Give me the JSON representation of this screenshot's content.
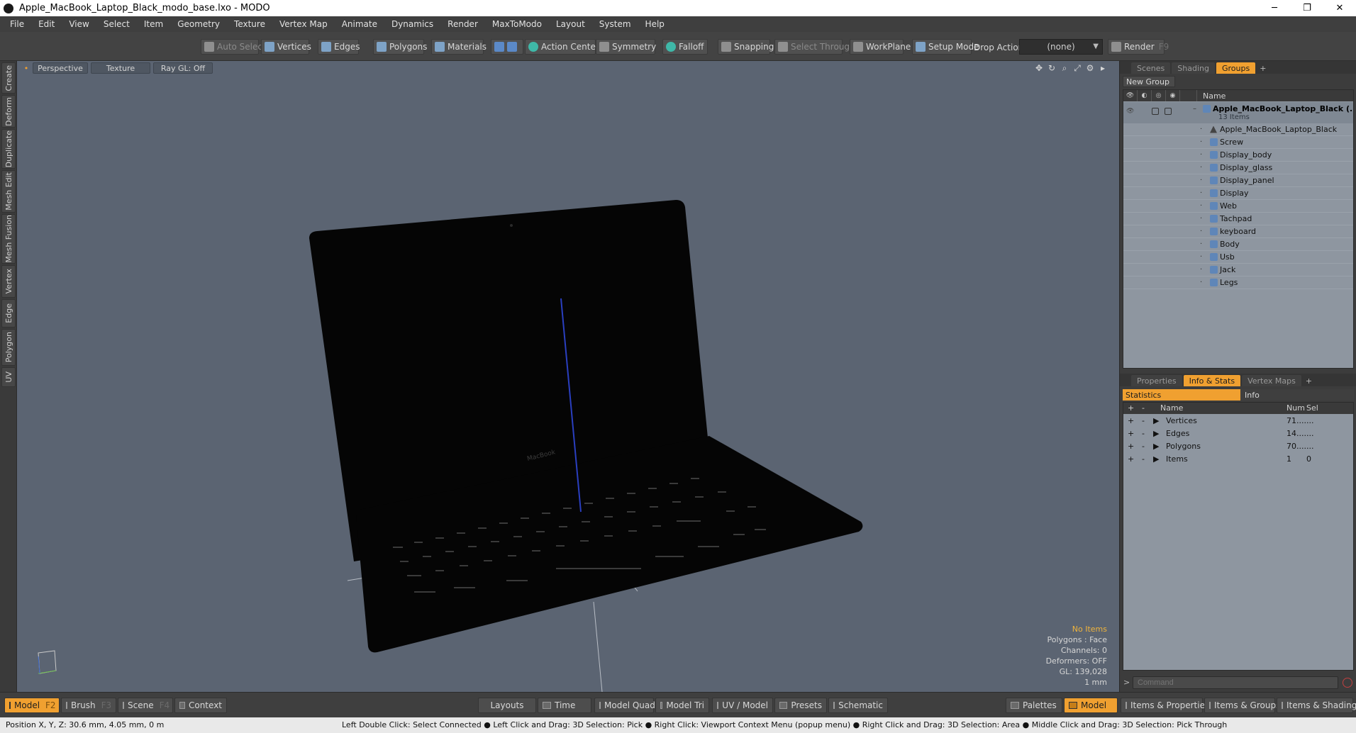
{
  "window": {
    "title": "Apple_MacBook_Laptop_Black_modo_base.lxo - MODO",
    "controls": {
      "minimize": "─",
      "maximize": "❐",
      "close": "✕"
    }
  },
  "menu": [
    "File",
    "Edit",
    "View",
    "Select",
    "Item",
    "Geometry",
    "Texture",
    "Vertex Map",
    "Animate",
    "Dynamics",
    "Render",
    "MaxToModo",
    "Layout",
    "System",
    "Help"
  ],
  "toolbar": {
    "auto_select": "Auto Select",
    "vertices": "Vertices",
    "edges": "Edges",
    "polygons": "Polygons",
    "materials": "Materials",
    "action_center": "Action Center",
    "symmetry": "Symmetry",
    "falloff": "Falloff",
    "snapping": "Snapping",
    "select_through": "Select Through",
    "workplane": "WorkPlane",
    "setup_mode": "Setup Mode",
    "drop_action": "Drop Action",
    "drop_value": "(none)",
    "render": "Render",
    "render_key": "F9"
  },
  "left_tabs": [
    "Create",
    "Deform",
    "Duplicate",
    "Mesh Edit",
    "Mesh Fusion",
    "Vertex",
    "Edge",
    "Polygon",
    "UV"
  ],
  "viewport": {
    "view": "Perspective",
    "shading": "Texture",
    "raygl": "Ray GL: Off",
    "laptop_logo": "MacBook",
    "info": {
      "selection": "No Items",
      "polygons": "Polygons : Face",
      "channels": "Channels: 0",
      "deformers": "Deformers: OFF",
      "gl": "GL: 139,028",
      "unit": "1 mm"
    },
    "colors": {
      "background": "#5b6472",
      "axis": "#2a3fc0"
    }
  },
  "items_panel": {
    "tabs": [
      "Scenes",
      "Shading",
      "Groups"
    ],
    "active_tab": "Groups",
    "new_group": "New Group",
    "name_header": "Name",
    "root": {
      "name": "Apple_MacBook_Laptop_Black",
      "suffix": "(...",
      "count": "13 Items"
    },
    "items": [
      "Apple_MacBook_Laptop_Black",
      "Screw",
      "Display_body",
      "Display_glass",
      "Display_panel",
      "Display",
      "Web",
      "Tachpad",
      "keyboard",
      "Body",
      "Usb",
      "Jack",
      "Legs"
    ]
  },
  "stats_panel": {
    "tabs": [
      "Properties",
      "Info & Stats",
      "Vertex Maps"
    ],
    "active_tab": "Info & Stats",
    "sub_tabs": [
      "Statistics",
      "Info"
    ],
    "headers": {
      "name": "Name",
      "num": "Num",
      "sel": "Sel"
    },
    "rows": [
      {
        "name": "Vertices",
        "num": "71....",
        "sel": "..."
      },
      {
        "name": "Edges",
        "num": "14....",
        "sel": "..."
      },
      {
        "name": "Polygons",
        "num": "70....",
        "sel": "..."
      },
      {
        "name": "Items",
        "num": "1",
        "sel": "0"
      }
    ],
    "command_placeholder": "Command"
  },
  "bottom_bar": {
    "model": "Model",
    "model_key": "F2",
    "brush": "Brush",
    "brush_key": "F3",
    "scene": "Scene",
    "scene_key": "F4",
    "context": "Context",
    "layouts": "Layouts",
    "time": "Time",
    "model_quad": "Model Quad",
    "model_tri": "Model Tri",
    "uv_model": "UV / Model",
    "presets": "Presets",
    "schematic": "Schematic",
    "palettes": "Palettes",
    "model_right": "Model",
    "items_properties": "Items & Properties",
    "items_groups": "Items & Groups",
    "items_shading": "Items & Shading"
  },
  "status": {
    "position": "Position X, Y, Z:   30.6 mm, 4.05 mm, 0 m",
    "hint": "Left Double Click: Select Connected ● Left Click and Drag: 3D Selection: Pick ● Right Click: Viewport Context Menu (popup menu) ● Right Click and Drag: 3D Selection: Area ● Middle Click and Drag: 3D Selection: Pick Through"
  },
  "colors": {
    "accent": "#f0a030",
    "panel": "#8e96a0"
  }
}
